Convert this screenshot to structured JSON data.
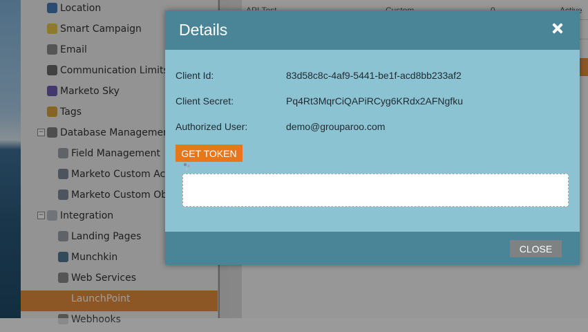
{
  "background": {
    "table_cells": [
      "API Test",
      "Custom",
      "0",
      "Active"
    ]
  },
  "sidebar": {
    "items": [
      {
        "label": "Location",
        "icon": "location-icon",
        "color": "#4a78b5"
      },
      {
        "label": "Smart Campaign",
        "icon": "lightbulb-icon",
        "color": "#e6c34a"
      },
      {
        "label": "Email",
        "icon": "email-icon",
        "color": "#8a8a8a"
      },
      {
        "label": "Communication Limits",
        "icon": "limits-icon",
        "color": "#6a6a6a"
      },
      {
        "label": "Marketo Sky",
        "icon": "bird-icon",
        "color": "#6b5bb0"
      },
      {
        "label": "Tags",
        "icon": "tag-icon",
        "color": "#d9a23b"
      },
      {
        "label": "Database Management",
        "icon": "database-icon",
        "color": "#7f7f7f",
        "expanded": true
      },
      {
        "label": "Field Management",
        "icon": "field-icon",
        "color": "#9aa0a6"
      },
      {
        "label": "Marketo Custom Actions",
        "icon": "custom-actions-icon",
        "color": "#7d8896"
      },
      {
        "label": "Marketo Custom Objects",
        "icon": "custom-objects-icon",
        "color": "#7d8896"
      },
      {
        "label": "Integration",
        "icon": "cloud-icon",
        "color": "#b5bcc4",
        "expanded": true
      },
      {
        "label": "Landing Pages",
        "icon": "landing-pages-icon",
        "color": "#9aa0a6"
      },
      {
        "label": "Munchkin",
        "icon": "munchkin-icon",
        "color": "#4f7a93"
      },
      {
        "label": "Web Services",
        "icon": "web-services-icon",
        "color": "#8a8a8a"
      },
      {
        "label": "LaunchPoint",
        "icon": "rocket-icon",
        "color": "#e48b3c",
        "selected": true
      },
      {
        "label": "Webhooks",
        "icon": "webhooks-icon",
        "color": "#8a8a8a"
      }
    ]
  },
  "modal": {
    "title": "Details",
    "fields": [
      {
        "label": "Client Id:",
        "value": "83d58c8c-4af9-5441-be1f-acd8bb233af2"
      },
      {
        "label": "Client Secret:",
        "value": "Pq4Rt3MqrCiQAPiRCyg6KRdx2AFNgfku"
      },
      {
        "label": "Authorized User:",
        "value": "demo@grouparoo.com"
      }
    ],
    "get_token_label": "GET TOKEN",
    "token_output_value": "",
    "close_label": "CLOSE"
  },
  "colors": {
    "header": "#4a8597",
    "body": "#8cc3d3",
    "accent": "#e8761b",
    "close_button": "#7f8283"
  }
}
